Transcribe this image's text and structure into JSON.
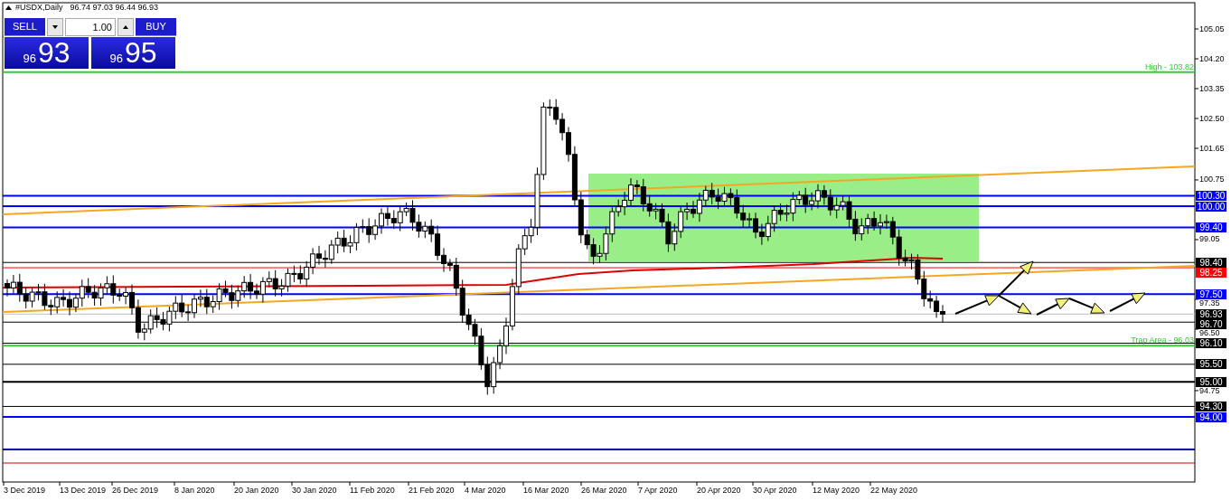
{
  "chart_header": {
    "symbol": "#USDX,Daily",
    "ohlc": "96.74 97.03 96.44 96.93"
  },
  "trade_panel": {
    "sell_label": "SELL",
    "lot": "1.00",
    "buy_label": "BUY",
    "sell_price": {
      "prefix": "96",
      "main": "93"
    },
    "buy_price": {
      "prefix": "96",
      "main": "95"
    }
  },
  "annotations": [
    {
      "text": "High - 103.82"
    },
    {
      "text": "Trap Area - 96.03"
    }
  ],
  "levels": [
    {
      "label": "100.30",
      "color": "#0000ff",
      "kind": "heavy"
    },
    {
      "label": "100.00",
      "color": "#0000ff",
      "kind": "heavy"
    },
    {
      "label": "99.40",
      "color": "#0000ff",
      "kind": "heavy"
    },
    {
      "label": "98.40",
      "color": "#000000",
      "kind": "light"
    },
    {
      "label": "98.25",
      "color": "#ff0000",
      "kind": "light"
    },
    {
      "label": "97.50",
      "color": "#0000ff",
      "kind": "heavy"
    },
    {
      "label": "96.93",
      "color": "#000000",
      "kind": "bid"
    },
    {
      "label": "96.70",
      "color": "#000000",
      "kind": "light"
    },
    {
      "label": "96.10",
      "color": "#000000",
      "kind": "light"
    },
    {
      "label": "95.50",
      "color": "#000000",
      "kind": "light"
    },
    {
      "label": "95.00",
      "color": "#000000",
      "kind": "heavy"
    },
    {
      "label": "94.30",
      "color": "#000000",
      "kind": "light"
    },
    {
      "label": "94.00",
      "color": "#0000ff",
      "kind": "heavy"
    }
  ],
  "price_axis": {
    "ticks": [
      "105.05",
      "104.20",
      "103.35",
      "102.50",
      "101.65",
      "100.75",
      "99.05",
      "97.35",
      "96.50",
      "94.75"
    ]
  },
  "time_axis": {
    "labels": [
      "3 Dec 2019",
      "13 Dec 2019",
      "26 Dec 2019",
      "8 Jan 2020",
      "20 Jan 2020",
      "30 Jan 2020",
      "11 Feb 2020",
      "21 Feb 2020",
      "4 Mar 2020",
      "16 Mar 2020",
      "26 Mar 2020",
      "7 Apr 2020",
      "20 Apr 2020",
      "30 Apr 2020",
      "12 May 2020",
      "22 May 2020"
    ]
  }
}
